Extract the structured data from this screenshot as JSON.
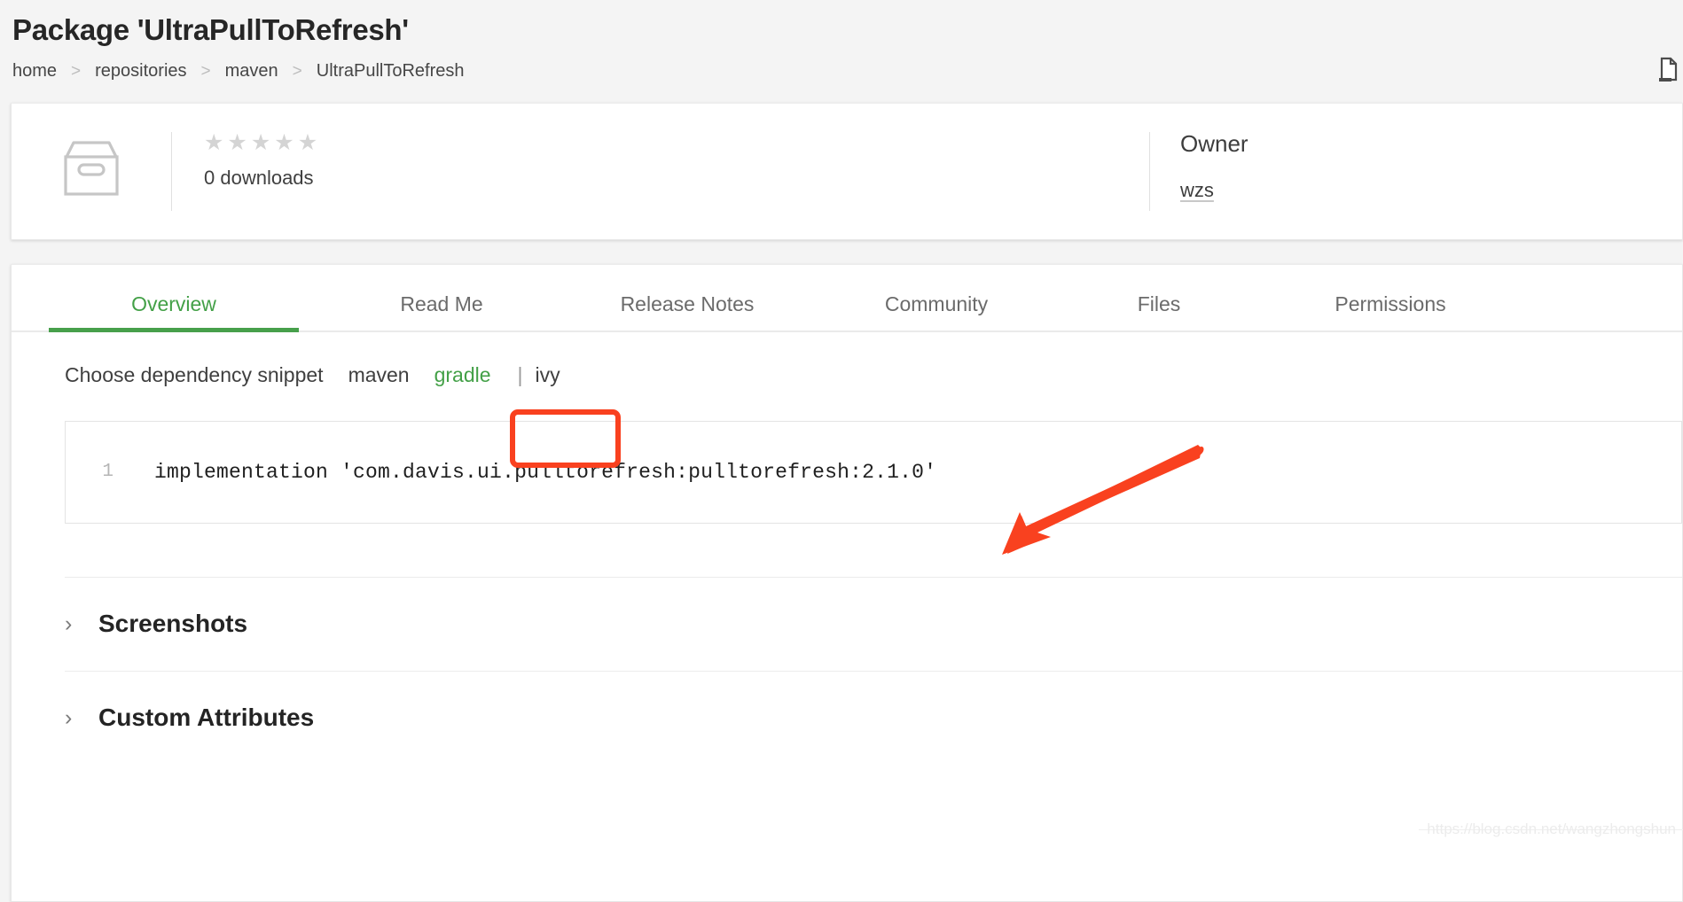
{
  "page": {
    "title": "Package 'UltraPullToRefresh'",
    "background_color": "#f4f4f4",
    "accent_green": "#43a047",
    "annotation_red": "#f9411f"
  },
  "breadcrumb": {
    "separator": ">",
    "items": [
      {
        "label": "home"
      },
      {
        "label": "repositories"
      },
      {
        "label": "maven"
      },
      {
        "label": "UltraPullToRefresh"
      }
    ]
  },
  "header_actions": {
    "copy_icon": "copy-page-icon"
  },
  "info_card": {
    "package_icon": "archive-box-icon",
    "rating": {
      "star_icon": "star-icon",
      "stars_total": 5,
      "stars_filled": 0,
      "star_glyph": "★"
    },
    "downloads_text": "0 downloads",
    "owner_heading": "Owner",
    "owner_name": "wzs"
  },
  "tabs": [
    {
      "label": "Overview",
      "active": true
    },
    {
      "label": "Read Me",
      "active": false
    },
    {
      "label": "Release Notes",
      "active": false
    },
    {
      "label": "Community",
      "active": false
    },
    {
      "label": "Files",
      "active": false
    },
    {
      "label": "Permissions",
      "active": false
    }
  ],
  "snippet": {
    "label": "Choose dependency snippet",
    "options": [
      {
        "label": "maven",
        "selected": false
      },
      {
        "label": "gradle",
        "selected": true
      },
      {
        "label": "ivy",
        "selected": false
      }
    ],
    "separator": "|",
    "code_line_number": "1",
    "code": "implementation 'com.davis.ui.pulltorefresh:pulltorefresh:2.1.0'"
  },
  "accordions": [
    {
      "label": "Screenshots",
      "chevron": "›",
      "expanded": false
    },
    {
      "label": "Custom Attributes",
      "chevron": "›",
      "expanded": false
    }
  ],
  "annotations": {
    "highlight_box_target": "gradle",
    "arrow_points_to": "dependency-code-line"
  },
  "watermark": {
    "text": "https://blog.csdn.net/wangzhongshun"
  }
}
